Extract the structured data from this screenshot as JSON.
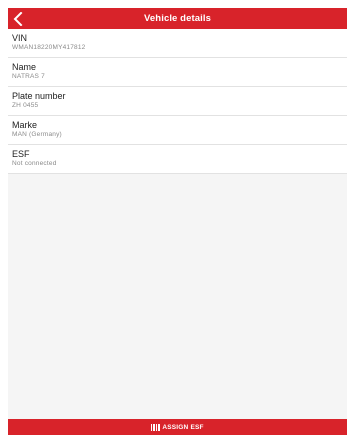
{
  "header": {
    "title": "Vehicle details"
  },
  "fields": [
    {
      "label": "VIN",
      "value": "WMAN18220MY417812"
    },
    {
      "label": "Name",
      "value": "NATRAS 7"
    },
    {
      "label": "Plate number",
      "value": "ZH 0455"
    },
    {
      "label": "Marke",
      "value": "MAN (Germany)"
    },
    {
      "label": "ESF",
      "value": "Not connected"
    }
  ],
  "footer": {
    "assign_label": "ASSIGN ESF"
  },
  "icons": {
    "back": "chevron-left-icon",
    "assign": "barcode-icon"
  },
  "colors": {
    "accent": "#d8232a",
    "background": "#f5f5f5"
  }
}
